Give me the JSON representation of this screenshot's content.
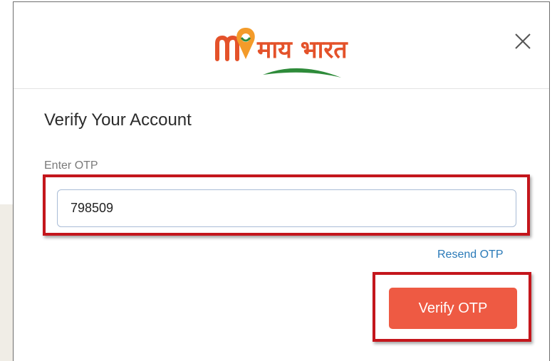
{
  "modal": {
    "logo_text": "माय भारत",
    "title": "Verify Your Account",
    "otp_label": "Enter OTP",
    "otp_value": "798509",
    "resend_label": "Resend OTP",
    "verify_label": "Verify OTP"
  },
  "colors": {
    "brand_orange": "#ee5a43",
    "link_blue": "#2a7ab8",
    "highlight_red": "#c4161c",
    "logo_green": "#2e8b3a"
  },
  "icons": {
    "close": "close-icon",
    "logo": "my-bharat-logo-icon"
  }
}
